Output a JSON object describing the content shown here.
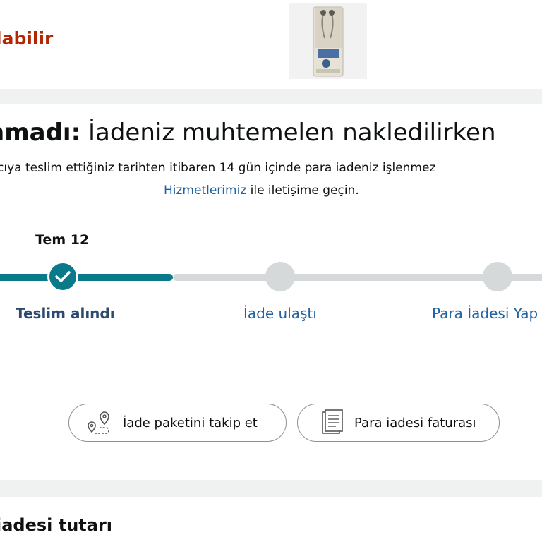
{
  "header": {
    "status_partial": "labilir"
  },
  "notice": {
    "title_bold": "nmadı:",
    "title_rest": " İadeniz muhtemelen nakledilirken",
    "body_line1": "cıya teslim ettiğiniz tarihten itibaren 14 gün içinde para iadeniz işlenmez",
    "link_text": "Hizmetlerimiz",
    "body_line2_rest": " ile iletişime geçin."
  },
  "tracker": {
    "date": "Tem 12",
    "steps": [
      {
        "label": "Teslim alındı",
        "state": "done"
      },
      {
        "label": "İade ulaştı",
        "state": "pending"
      },
      {
        "label": "Para İadesi Yap",
        "state": "pending"
      }
    ]
  },
  "actions": {
    "track_label": "İade paketini takip et",
    "invoice_label": "Para iadesi faturası"
  },
  "refund": {
    "section_title": "iadesi tutarı"
  },
  "icons": {
    "check": "check-icon",
    "track": "map-pin-route-icon",
    "invoice": "document-icon",
    "product": "product-image"
  },
  "colors": {
    "accent": "#0a7a8a",
    "link": "#2162a1",
    "alert": "#b12704",
    "inactive": "#d5d9d9"
  }
}
